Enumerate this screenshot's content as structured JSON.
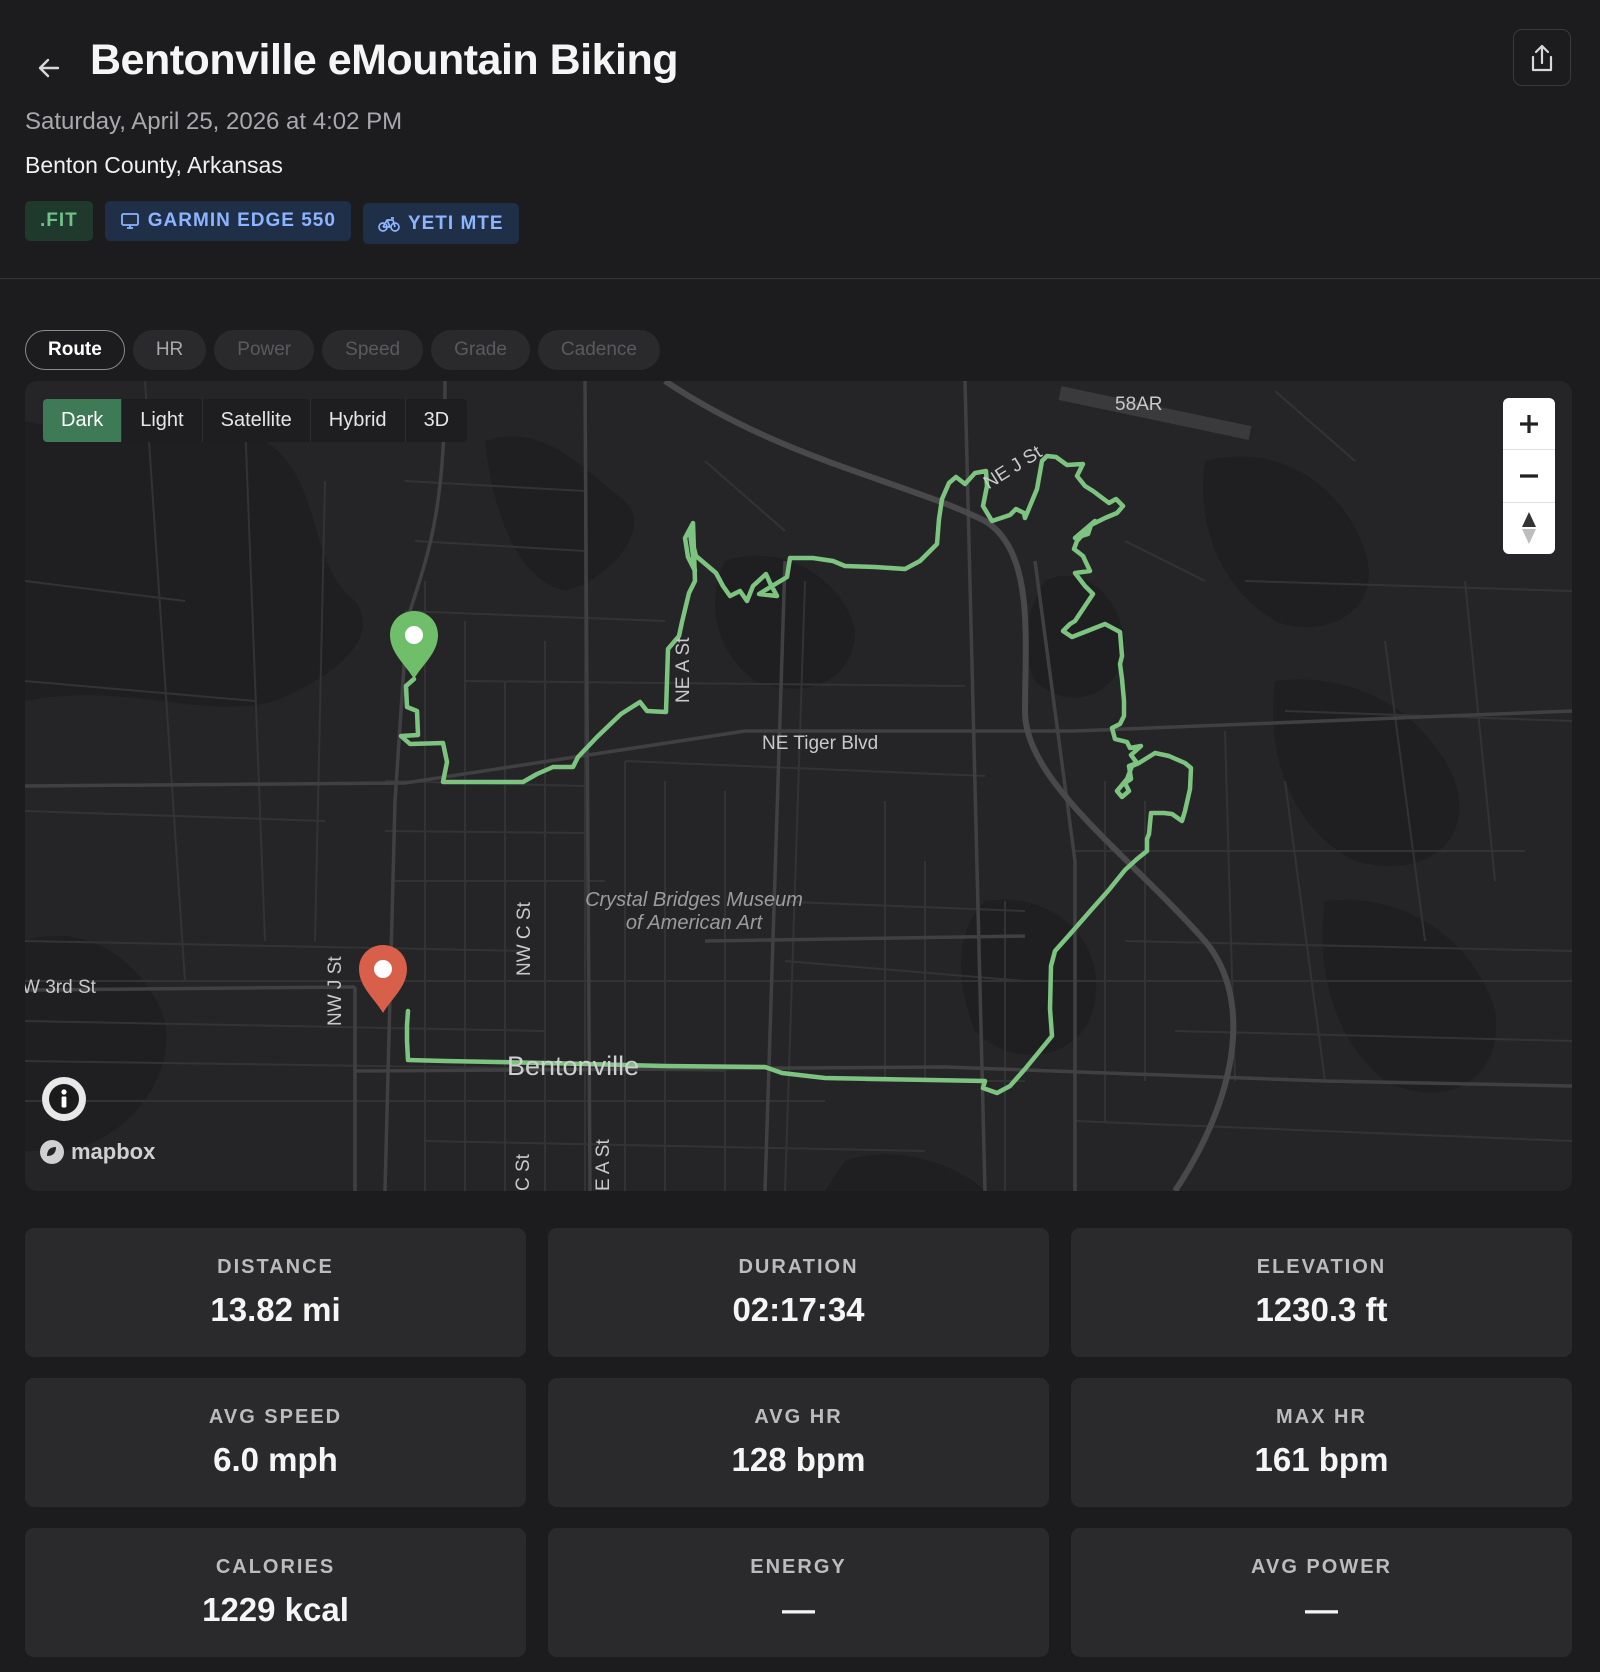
{
  "header": {
    "title": "Bentonville eMountain Biking",
    "datetime": "Saturday, April 25, 2026 at 4:02 PM",
    "location": "Benton County, Arkansas",
    "badges": [
      {
        "label": ".FIT",
        "icon": "file-type"
      },
      {
        "label": "GARMIN EDGE 550",
        "icon": "device-icon"
      },
      {
        "label": "YETI MTE",
        "icon": "bike-icon"
      }
    ]
  },
  "tabs": [
    {
      "label": "Route",
      "state": "active"
    },
    {
      "label": "HR",
      "state": "enabled"
    },
    {
      "label": "Power",
      "state": "disabled"
    },
    {
      "label": "Speed",
      "state": "disabled"
    },
    {
      "label": "Grade",
      "state": "disabled"
    },
    {
      "label": "Cadence",
      "state": "disabled"
    }
  ],
  "map": {
    "styles": [
      "Dark",
      "Light",
      "Satellite",
      "Hybrid",
      "3D"
    ],
    "active_style": "Dark",
    "labels": {
      "highway": "58AR",
      "ne_j_st": "NE J St",
      "ne_a_st": "NE A St",
      "ne_tiger": "NE Tiger Blvd",
      "museum_line1": "Crystal Bridges Museum",
      "museum_line2": "of American Art",
      "nw_c_st": "NW C St",
      "nw_j_st": "NW J St",
      "w_3rd": "W 3rd St",
      "city": "Bentonville",
      "c_st_bottom": "C St",
      "a_st_bottom": "E A St"
    },
    "attribution": "mapbox",
    "route_color": "#7cc47f",
    "start_marker_color": "#6fbf6a",
    "end_marker_color": "#d8604a"
  },
  "stats": [
    {
      "label": "DISTANCE",
      "value": "13.82 mi"
    },
    {
      "label": "DURATION",
      "value": "02:17:34"
    },
    {
      "label": "ELEVATION",
      "value": "1230.3 ft"
    },
    {
      "label": "AVG SPEED",
      "value": "6.0 mph"
    },
    {
      "label": "AVG HR",
      "value": "128 bpm"
    },
    {
      "label": "MAX HR",
      "value": "161 bpm"
    },
    {
      "label": "CALORIES",
      "value": "1229 kcal"
    },
    {
      "label": "ENERGY",
      "value": "—"
    },
    {
      "label": "AVG POWER",
      "value": "—"
    }
  ]
}
